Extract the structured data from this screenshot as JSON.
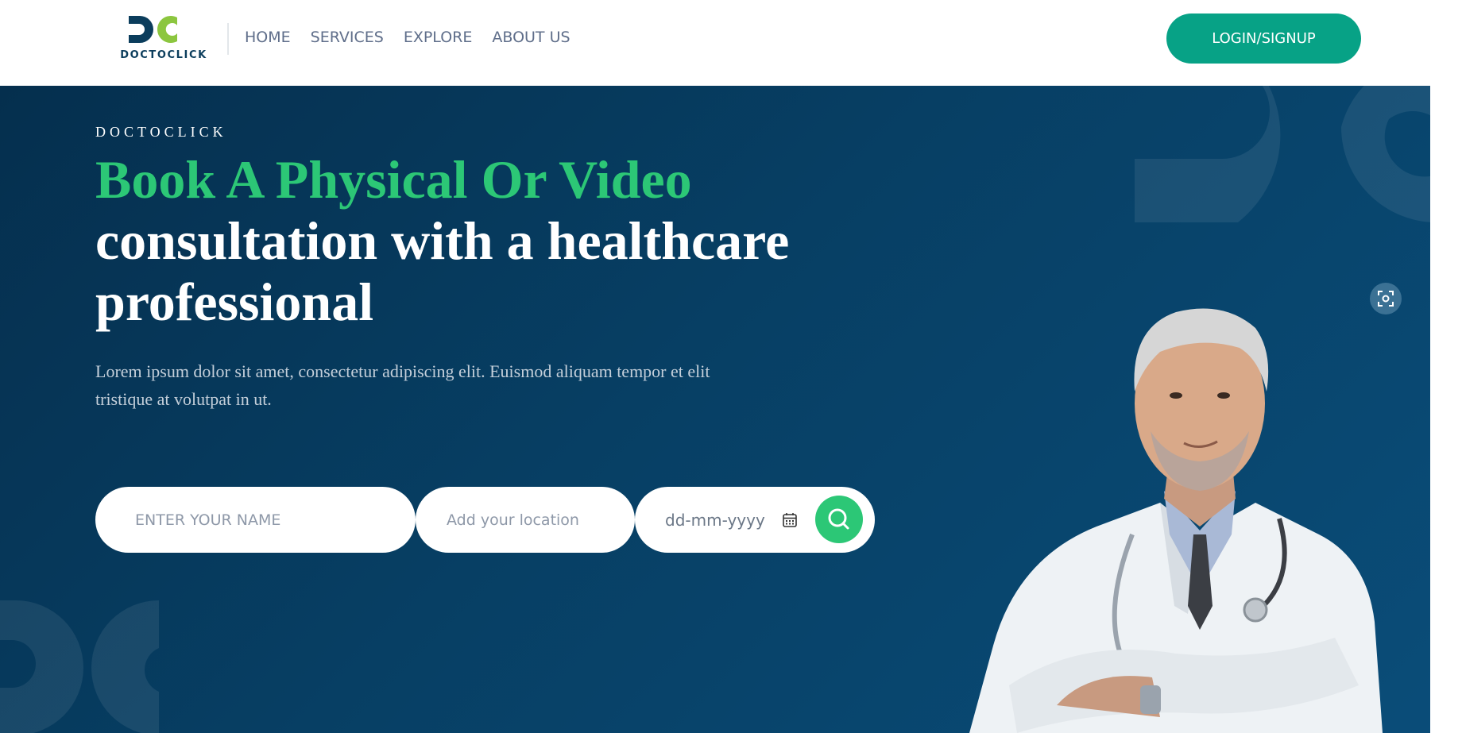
{
  "brand": {
    "logo_text": "DOCTOCLICK",
    "colors": {
      "green": "#2cc776",
      "teal": "#07a286",
      "navy": "#063a5e"
    }
  },
  "nav": {
    "links": [
      "HOME",
      "SERVICES",
      "EXPLORE",
      "ABOUT US"
    ],
    "login_label": "LOGIN/SIGNUP"
  },
  "hero": {
    "eyebrow": "DOCTOCLICK",
    "headline_green": "Book A Physical Or Video",
    "headline_white": "consultation with a healthcare professional",
    "description": "Lorem ipsum dolor sit amet, consectetur adipiscing elit. Euismod aliquam tempor et elit tristique at volutpat in ut."
  },
  "search": {
    "name_placeholder": "ENTER YOUR NAME",
    "location_placeholder": "Add your location",
    "date_placeholder": "dd-mm-yyyy"
  },
  "icons": {
    "calendar": "calendar-icon",
    "search": "search-icon",
    "focus": "focus-scan-icon"
  }
}
